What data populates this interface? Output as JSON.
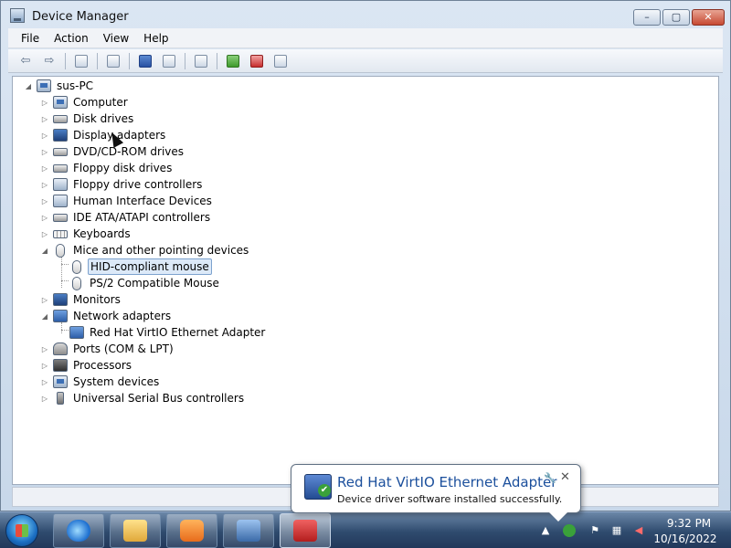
{
  "window": {
    "title": "Device Manager",
    "controls": {
      "minimize": "–",
      "maximize": "▢",
      "close": "✕"
    }
  },
  "menu": [
    "File",
    "Action",
    "View",
    "Help"
  ],
  "toolbar": {
    "buttons": [
      "back-icon",
      "forward-icon",
      "show-hide-console-tree-icon",
      "properties-icon",
      "help-icon",
      "action-pane-icon",
      "scan-hardware-icon",
      "update-driver-icon",
      "uninstall-icon",
      "disable-icon"
    ]
  },
  "tree": {
    "root": {
      "label": "sus-PC",
      "icon": "computer-icon",
      "expander": "◢"
    },
    "categories": [
      {
        "label": "Computer",
        "icon": "computer-icon",
        "expander": "▷"
      },
      {
        "label": "Disk drives",
        "icon": "disk-drive-icon",
        "expander": "▷"
      },
      {
        "label": "Display adapters",
        "icon": "display-adapter-icon",
        "expander": "▷"
      },
      {
        "label": "DVD/CD-ROM drives",
        "icon": "dvd-drive-icon",
        "expander": "▷"
      },
      {
        "label": "Floppy disk drives",
        "icon": "floppy-drive-icon",
        "expander": "▷"
      },
      {
        "label": "Floppy drive controllers",
        "icon": "floppy-controller-icon",
        "expander": "▷"
      },
      {
        "label": "Human Interface Devices",
        "icon": "hid-icon",
        "expander": "▷"
      },
      {
        "label": "IDE ATA/ATAPI controllers",
        "icon": "ide-controller-icon",
        "expander": "▷"
      },
      {
        "label": "Keyboards",
        "icon": "keyboard-icon",
        "expander": "▷"
      },
      {
        "label": "Mice and other pointing devices",
        "icon": "mouse-icon",
        "expander": "◢",
        "children": [
          {
            "label": "HID-compliant mouse",
            "icon": "mouse-icon",
            "selected": true
          },
          {
            "label": "PS/2 Compatible Mouse",
            "icon": "mouse-icon"
          }
        ]
      },
      {
        "label": "Monitors",
        "icon": "monitor-icon",
        "expander": "▷"
      },
      {
        "label": "Network adapters",
        "icon": "network-adapter-icon",
        "expander": "◢",
        "children": [
          {
            "label": "Red Hat VirtIO Ethernet Adapter",
            "icon": "network-adapter-icon"
          }
        ]
      },
      {
        "label": "Ports (COM & LPT)",
        "icon": "port-icon",
        "expander": "▷"
      },
      {
        "label": "Processors",
        "icon": "processor-icon",
        "expander": "▷"
      },
      {
        "label": "System devices",
        "icon": "system-device-icon",
        "expander": "▷"
      },
      {
        "label": "Universal Serial Bus controllers",
        "icon": "usb-icon",
        "expander": "▷"
      }
    ]
  },
  "notification": {
    "title": "Red Hat VirtIO Ethernet Adapter",
    "message": "Device driver software installed successfully.",
    "tool_glyph": "🔧",
    "close_glyph": "✕"
  },
  "taskbar": {
    "pinned": [
      "internet-explorer-icon",
      "windows-explorer-icon",
      "media-player-icon",
      "device-manager-icon",
      "toolbox-icon"
    ],
    "tray_icons": [
      "show-hidden-icons-icon",
      "driver-install-icon",
      "action-center-flag-icon",
      "network-icon",
      "volume-muted-icon"
    ],
    "tray_glyphs": {
      "show_hidden": "▲",
      "flag": "⚑",
      "network": "▦",
      "volume": "◀"
    },
    "clock": {
      "time": "9:32 PM",
      "date": "10/16/2022"
    }
  }
}
